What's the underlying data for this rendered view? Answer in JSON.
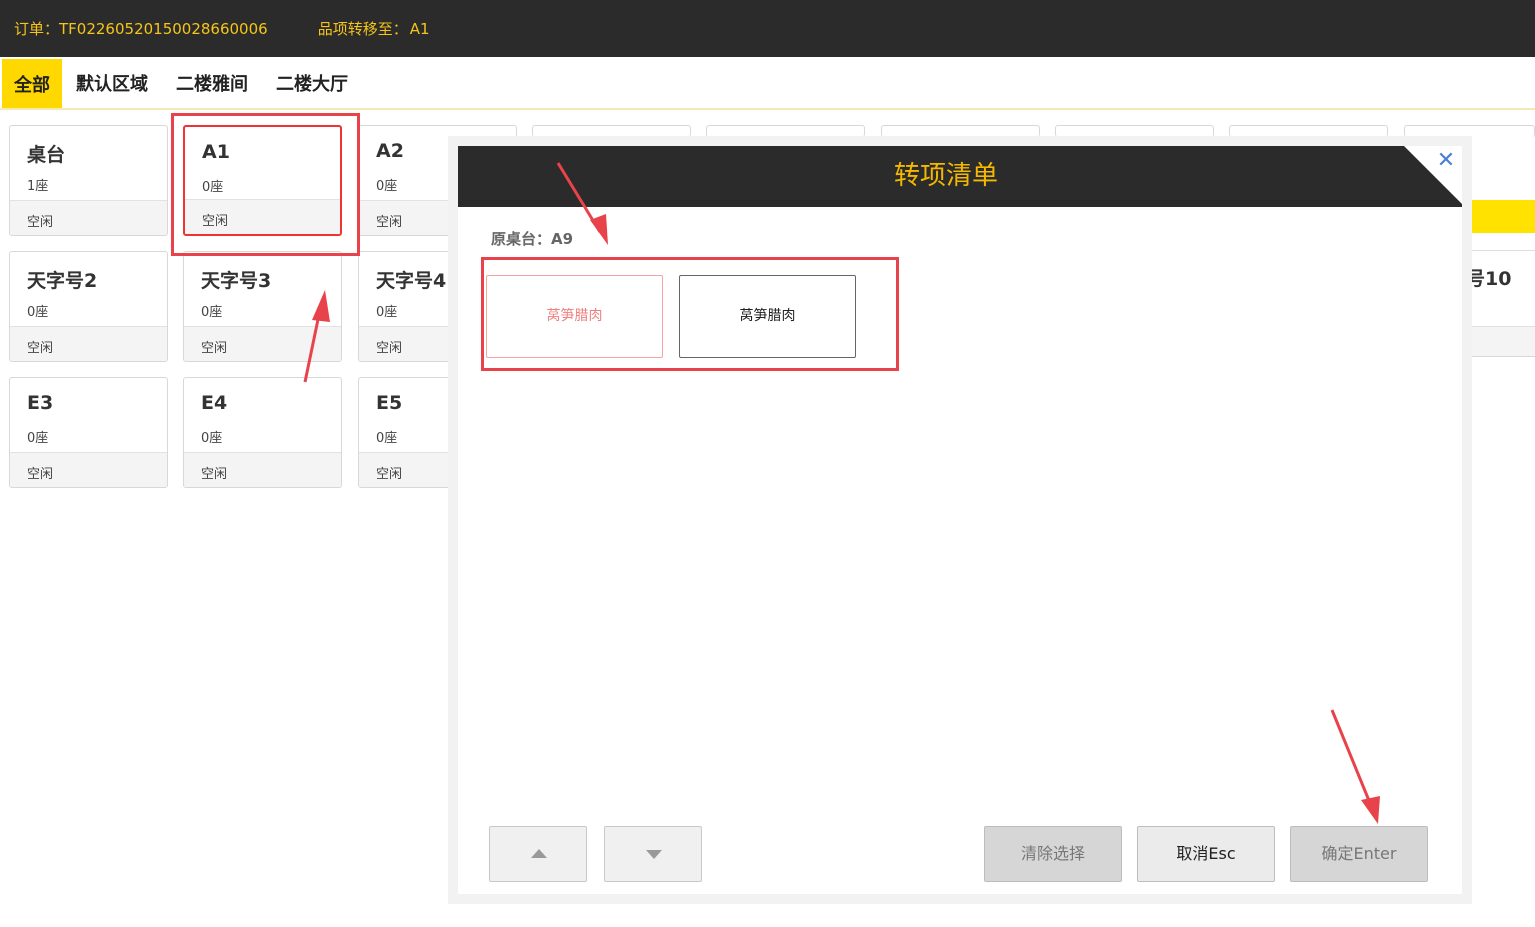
{
  "header": {
    "order_label": "订单：",
    "order_number": "TF02260520150028660006",
    "transfer_label": "品项转移至：",
    "transfer_target": "A1"
  },
  "tabs": [
    {
      "label": "全部",
      "active": true
    },
    {
      "label": "默认区域",
      "active": false
    },
    {
      "label": "二楼雅间",
      "active": false
    },
    {
      "label": "二楼大厅",
      "active": false
    }
  ],
  "tables": [
    {
      "name": "桌台",
      "seats": "1座",
      "status": "空闲"
    },
    {
      "name": "A1",
      "seats": "0座",
      "status": "空闲"
    },
    {
      "name": "A2",
      "seats": "0座",
      "status": "空闲"
    },
    {
      "name": "天字号2",
      "seats": "0座",
      "status": "空闲"
    },
    {
      "name": "天字号3",
      "seats": "0座",
      "status": "空闲"
    },
    {
      "name": "天字号4",
      "seats": "0座",
      "status": "空闲"
    },
    {
      "name": "E3",
      "seats": "0座",
      "status": "空闲"
    },
    {
      "name": "E4",
      "seats": "0座",
      "status": "空闲"
    },
    {
      "name": "E5",
      "seats": "0座",
      "status": "空闲"
    }
  ],
  "right_partial_label": "号10",
  "modal": {
    "title": "转项清单",
    "close_icon": "close-icon",
    "source_label": "原桌台：",
    "source_table": "A9",
    "items": [
      {
        "label": "莴笋腊肉",
        "state": "selected"
      },
      {
        "label": "莴笋腊肉",
        "state": "normal"
      }
    ],
    "buttons": {
      "clear": "清除选择",
      "cancel": "取消Esc",
      "confirm": "确定Enter"
    }
  },
  "colors": {
    "header_bg": "#2b2b2b",
    "accent_yellow": "#ffd800",
    "title_orange": "#f5b800",
    "annotation_red": "#e8434a",
    "selected_item_text": "#f08080",
    "close_blue": "#4a7fd4"
  }
}
